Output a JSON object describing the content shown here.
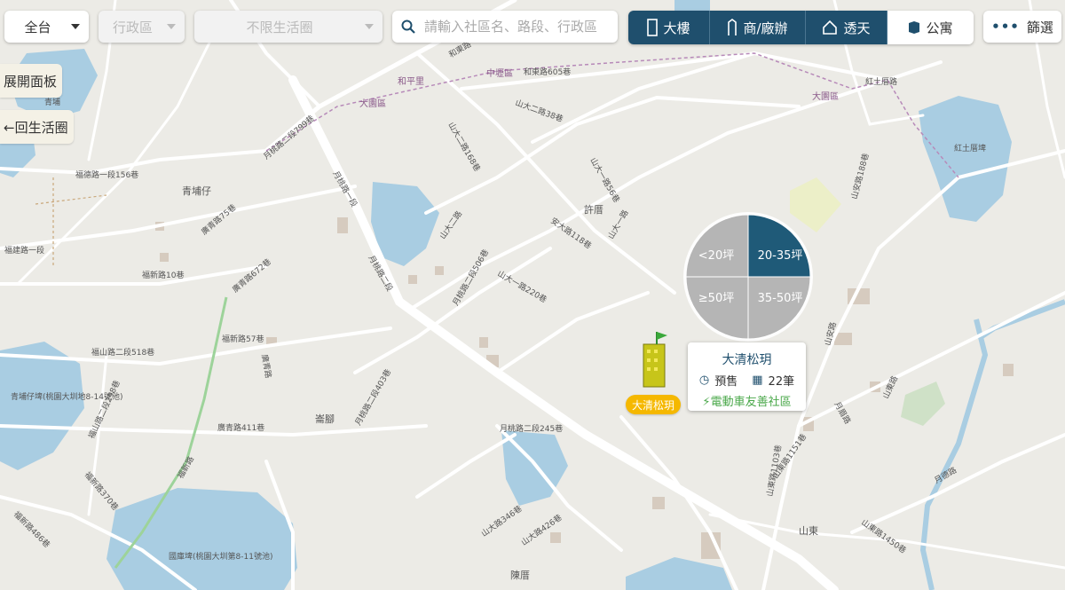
{
  "toolbar": {
    "region": "全台",
    "district": "行政區",
    "life_circle": "不限生活圈",
    "search_placeholder": "請輸入社區名、路段、行政區",
    "types": [
      {
        "label": "大樓",
        "active": true
      },
      {
        "label": "商/廠辦",
        "active": true
      },
      {
        "label": "透天",
        "active": true
      },
      {
        "label": "公寓",
        "active": false
      }
    ],
    "filter": "篩選"
  },
  "side": {
    "open_panel": "展開面板",
    "back_circle": "←回生活圈"
  },
  "pie": {
    "segments": [
      "<20坪",
      "20-35坪",
      "≥50坪",
      "35-50坪"
    ],
    "active": "20-35坪",
    "active_color": "#1f5a78",
    "inactive_color": "#b5b5b5"
  },
  "popup": {
    "name": "大清松玥",
    "status": "預售",
    "count": "22筆",
    "tag": "電動車友善社區"
  },
  "marker": {
    "label": "大清松玥"
  },
  "map_labels": {
    "places": [
      "青埔仔",
      "許厝",
      "崙腳",
      "山東",
      "陳厝"
    ],
    "lakes": [
      "青埔",
      "紅土厝埤",
      "青埔仔埤(桃園大圳地8-14號池)",
      "國庫埤(桃園大圳第8-11號池)"
    ],
    "districts": [
      "大園區",
      "中壢區",
      "和平里"
    ],
    "roads": [
      "和東路",
      "和東路605巷",
      "山大二路38巷",
      "山大二路168巷",
      "月桃路二段799巷",
      "月桃路一段",
      "月桃路二段",
      "月桃路二段506巷",
      "月桃路二段403巷",
      "月桃路二段245巷",
      "山大一路56巷",
      "安大路118巷",
      "山大一路",
      "山大二路",
      "山大一路220巷",
      "廣青路75巷",
      "廣青路672巷",
      "廣青路411巷",
      "廣青路",
      "福新路10巷",
      "福新路370巷",
      "福新路486巷",
      "福山路二段518巷",
      "福山路二段298巷",
      "福新路57巷",
      "福德路一段156巷",
      "福建路一段",
      "福新路",
      "山東路",
      "山東路1151巷",
      "山東路1103巷",
      "山東路1450巷",
      "山大路346巷",
      "山大路426巷",
      "月德路",
      "紅土厝路",
      "山安路",
      "山安路188巷",
      "月眉路"
    ]
  }
}
